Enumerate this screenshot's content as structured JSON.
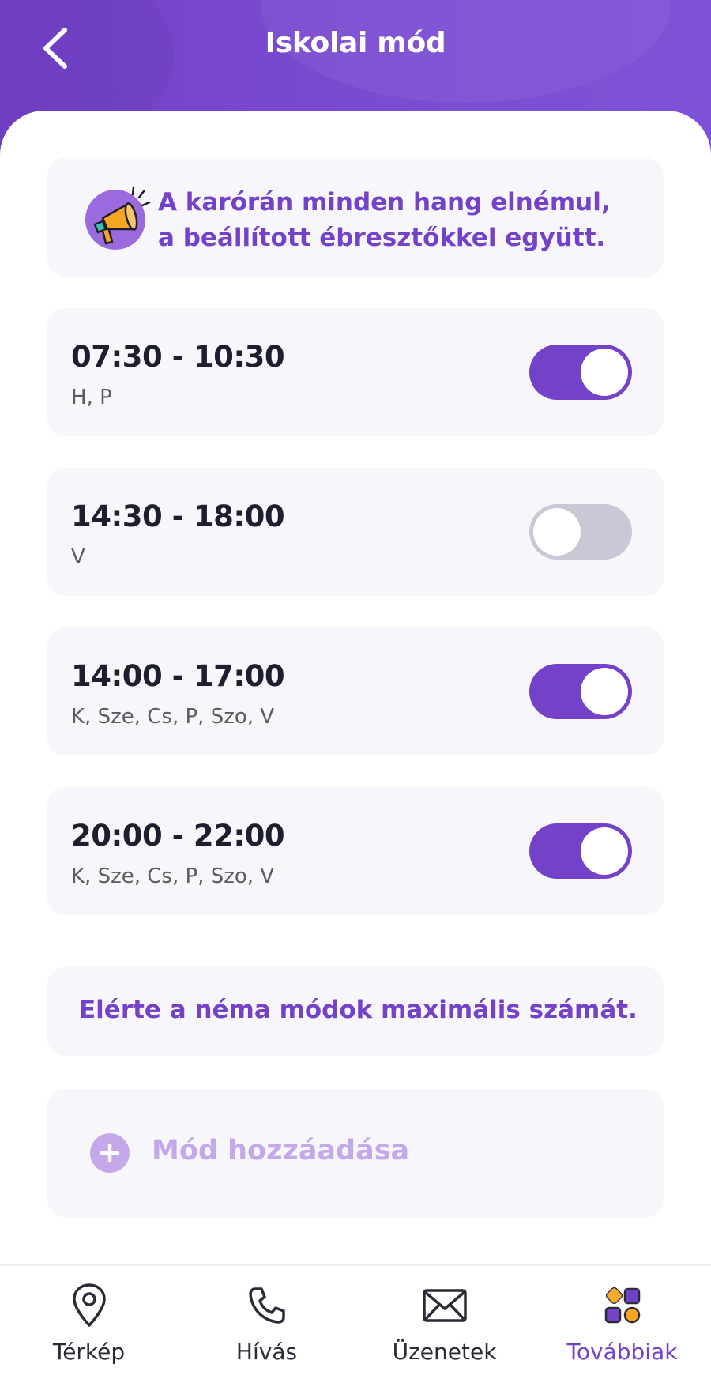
{
  "header": {
    "title": "Iskolai mód",
    "back_icon": "chevron-left-icon"
  },
  "info": {
    "icon": "megaphone-icon",
    "line1": "A karórán minden hang elnémul,",
    "line2": "a beállított ébresztőkkel együtt."
  },
  "modes": [
    {
      "time": "07:30 - 10:30",
      "days": "H, P",
      "enabled": true
    },
    {
      "time": "14:30 - 18:00",
      "days": "V",
      "enabled": false
    },
    {
      "time": "14:00 - 17:00",
      "days": "K, Sze, Cs, P, Szo, V",
      "enabled": true
    },
    {
      "time": "20:00 - 22:00",
      "days": "K, Sze, Cs, P, Szo, V",
      "enabled": true
    }
  ],
  "limit_message": "Elérte a néma módok maximális számát.",
  "add_mode": {
    "label": "Mód hozzáadása",
    "icon": "plus-circle-icon",
    "disabled": true
  },
  "nav": {
    "items": [
      {
        "label": "Térkép",
        "icon": "map-pin-icon",
        "active": false
      },
      {
        "label": "Hívás",
        "icon": "phone-icon",
        "active": false
      },
      {
        "label": "Üzenetek",
        "icon": "envelope-icon",
        "active": false
      },
      {
        "label": "Továbbiak",
        "icon": "grid-more-icon",
        "active": true
      }
    ]
  },
  "colors": {
    "primary": "#7442C8",
    "toggle_off": "#C8C8D6",
    "card_bg": "#F7F7FB",
    "disabled_accent": "#C4A8EA"
  }
}
